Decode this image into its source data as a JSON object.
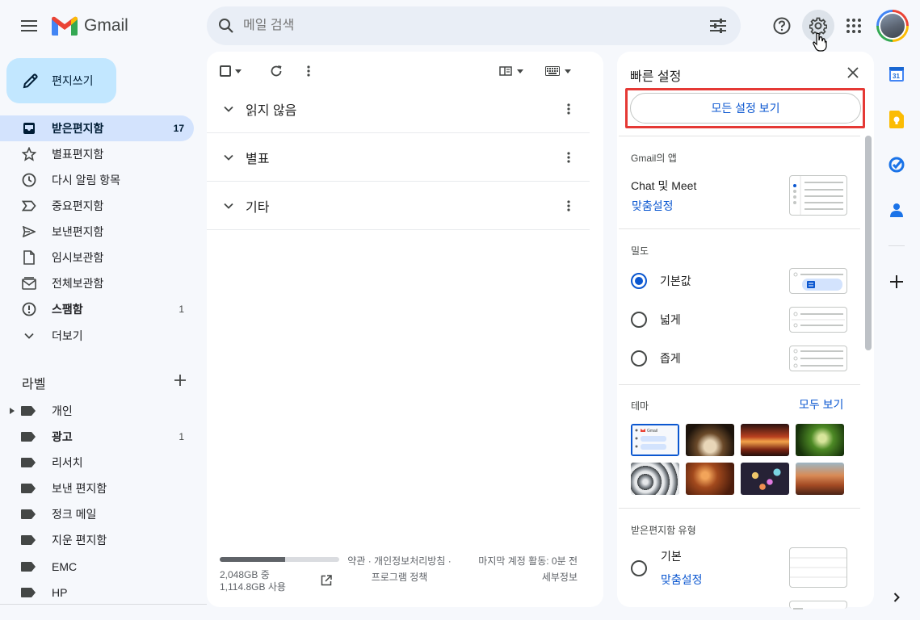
{
  "app": {
    "name": "Gmail"
  },
  "search": {
    "placeholder": "메일 검색"
  },
  "compose": {
    "label": "편지쓰기"
  },
  "nav": [
    {
      "label": "받은편지함",
      "count": "17",
      "icon": "inbox-icon"
    },
    {
      "label": "별표편지함",
      "count": "",
      "icon": "star-icon"
    },
    {
      "label": "다시 알림 항목",
      "count": "",
      "icon": "clock-icon"
    },
    {
      "label": "중요편지함",
      "count": "",
      "icon": "important-icon"
    },
    {
      "label": "보낸편지함",
      "count": "",
      "icon": "send-icon"
    },
    {
      "label": "임시보관함",
      "count": "",
      "icon": "draft-icon"
    },
    {
      "label": "전체보관함",
      "count": "",
      "icon": "all-mail-icon"
    },
    {
      "label": "스팸함",
      "count": "1",
      "icon": "spam-icon"
    },
    {
      "label": "더보기",
      "count": "",
      "icon": "chevron-down-icon"
    }
  ],
  "labels": {
    "title": "라벨",
    "items": [
      {
        "label": "개인",
        "count": ""
      },
      {
        "label": "광고",
        "count": "1"
      },
      {
        "label": "리서치",
        "count": ""
      },
      {
        "label": "보낸 편지함",
        "count": ""
      },
      {
        "label": "정크 메일",
        "count": ""
      },
      {
        "label": "지운 편지함",
        "count": ""
      },
      {
        "label": "EMC",
        "count": ""
      },
      {
        "label": "HP",
        "count": ""
      }
    ]
  },
  "main": {
    "sections": [
      {
        "title": "읽지 않음"
      },
      {
        "title": "별표"
      },
      {
        "title": "기타"
      }
    ]
  },
  "storage": {
    "text": "2,048GB 중 1,114.8GB 사용",
    "fraction": 0.544
  },
  "footer": {
    "links_line1": "약관 · 개인정보처리방침 ·",
    "links_line2": "프로그램 정책",
    "activity_line1": "마지막 계정 활동: 0분 전",
    "activity_line2": "세부정보"
  },
  "quick_settings": {
    "title": "빠른 설정",
    "all_settings": "모든 설정 보기",
    "apps_heading": "Gmail의 앱",
    "chat_title": "Chat 및 Meet",
    "chat_link": "맞춤설정",
    "density_heading": "밀도",
    "density_options": [
      {
        "label": "기본값",
        "selected": true
      },
      {
        "label": "넓게",
        "selected": false
      },
      {
        "label": "좁게",
        "selected": false
      }
    ],
    "theme_heading": "테마",
    "theme_all": "모두 보기",
    "theme_default_name": "Gmail",
    "inbox_type_heading": "받은편지함 유형",
    "inbox_basic": "기본",
    "inbox_link": "맞춤설정"
  },
  "colors": {
    "accent": "#0b57d0",
    "nav_active": "#d3e3fd",
    "compose_bg": "#c2e7ff",
    "highlight_box": "#e53935"
  }
}
